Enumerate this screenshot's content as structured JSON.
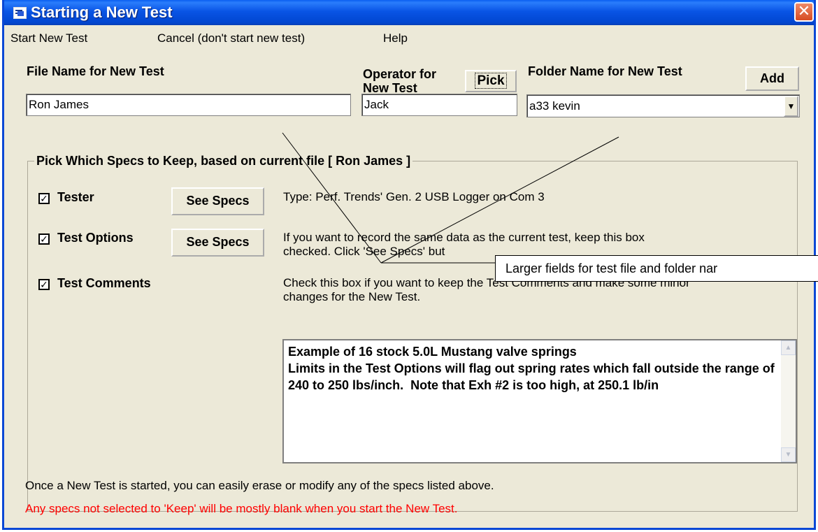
{
  "window": {
    "title": "Starting a New Test",
    "close_label": "✕"
  },
  "menu": [
    "Start New Test",
    "Cancel (don't start new test)",
    "Help"
  ],
  "file_name": {
    "label": "File Name for New Test",
    "value": "Ron James"
  },
  "operator": {
    "label_line1": "Operator for",
    "label_line2": "New Test",
    "value": "Jack",
    "pick_label": "Pick"
  },
  "folder": {
    "label": "Folder Name for New Test",
    "add_label": "Add",
    "value": "a33 kevin"
  },
  "specs_group": {
    "title": "Pick Which Specs to Keep, based on current file [ Ron James ]",
    "rows": [
      {
        "label": "Tester",
        "checked": true,
        "button": "See Specs",
        "desc1": "Type: Perf. Trends' Gen. 2 USB Logger on Com 3",
        "desc2": ""
      },
      {
        "label": "Test Options",
        "checked": true,
        "button": "See Specs",
        "desc1": "If you want to record the same data as the current test, keep this box",
        "desc2": "checked.  Click 'See Specs' but"
      },
      {
        "label": "Test Comments",
        "checked": true,
        "button": "",
        "desc1": "Check this box if you want to keep the Test Comments and make some minor",
        "desc2": "changes for the New Test."
      }
    ]
  },
  "comments": "Example of 16 stock 5.0L Mustang valve springs\nLimits in the Test Options will flag out spring rates which fall outside the range of 240 to 250 lbs/inch.  Note that Exh #2 is too high, at 250.1 lb/in",
  "footer": {
    "info": "Once a New Test is started, you can easily erase or modify any of the specs listed above.",
    "warning": "Any specs not selected to 'Keep' will be mostly blank when you start the New Test."
  },
  "callout": "Larger fields for test file and folder nar",
  "colors": {
    "title_bar": "#0a5ff0",
    "warning_text": "#ff0000",
    "window_bg": "#ece9d8"
  }
}
